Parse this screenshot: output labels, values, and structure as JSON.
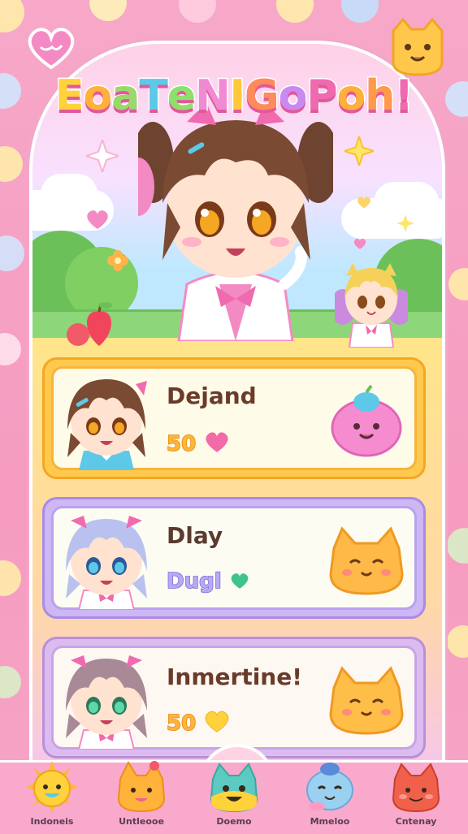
{
  "game": {
    "title": "EoaTeNIGoPoh!",
    "title_letters": [
      {
        "ch": "E",
        "color": "#ffd13b"
      },
      {
        "ch": "o",
        "color": "#ffb13b"
      },
      {
        "ch": "a",
        "color": "#9bd86b"
      },
      {
        "ch": "T",
        "color": "#5ec8e8"
      },
      {
        "ch": "e",
        "color": "#8fe06b"
      },
      {
        "ch": "N",
        "color": "#f08ad2"
      },
      {
        "ch": "I",
        "color": "#ffc83b"
      },
      {
        "ch": "G",
        "color": "#ff8a5b"
      },
      {
        "ch": "o",
        "color": "#c88af0"
      },
      {
        "ch": "P",
        "color": "#f06ab0"
      },
      {
        "ch": "o",
        "color": "#ffb03b"
      },
      {
        "ch": "h",
        "color": "#ff9a4b"
      },
      {
        "ch": "!",
        "color": "#f06ab0"
      }
    ]
  },
  "cards": [
    {
      "name": "Dejand",
      "stat": "50",
      "stat_icon": "sparkle-heart-icon",
      "avatar": "brown-hair-girl",
      "pet": "pink-blob-pet",
      "pet_color": "#f58cd0"
    },
    {
      "name": "Dlay",
      "stat": "Dugl",
      "stat_icon": "green-heart-icon",
      "avatar": "lavender-hair-girl",
      "pet": "orange-cat-pet",
      "pet_color": "#ffb948"
    },
    {
      "name": "Inmertine!",
      "stat": "50",
      "stat_icon": "yellow-heart-icon",
      "avatar": "mauve-hair-girl",
      "pet": "orange-cat-pet",
      "pet_color": "#ffbe48"
    }
  ],
  "nav": [
    {
      "label": "Indoneis",
      "icon": "sun-creature-icon",
      "color": "#ffd23b"
    },
    {
      "label": "Untleooe",
      "icon": "fox-creature-icon",
      "color": "#ffb33b"
    },
    {
      "label": "Doemo",
      "icon": "teal-cat-icon",
      "color": "#5cc9c2"
    },
    {
      "label": "Mmeloo",
      "icon": "seal-creature-icon",
      "color": "#9ad0f0"
    },
    {
      "label": "Cntenay",
      "icon": "red-cat-icon",
      "color": "#f0604b"
    }
  ],
  "colors": {
    "accent": "#f06ab0",
    "background": "#f7a8c8"
  }
}
